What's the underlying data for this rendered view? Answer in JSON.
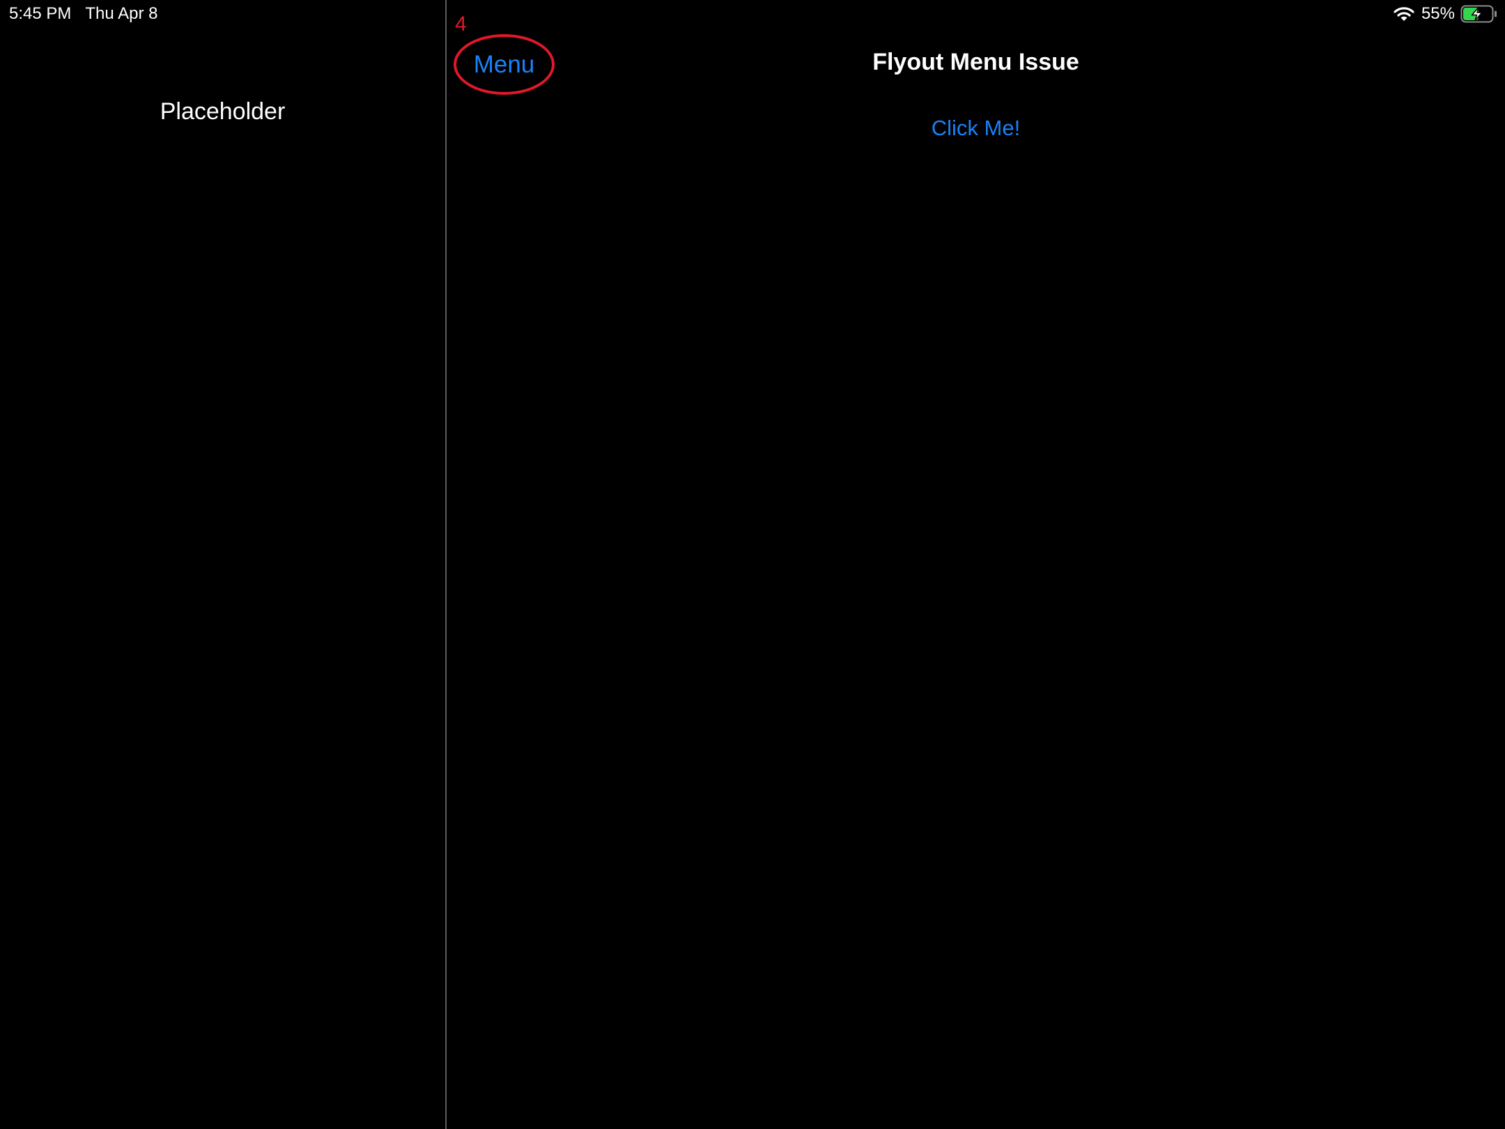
{
  "status_bar": {
    "time": "5:45 PM",
    "date": "Thu Apr 8",
    "battery_percent": "55%",
    "battery_level": 0.55,
    "battery_charging": true,
    "wifi_icon": "wifi-icon",
    "battery_icon": "battery-charging-icon",
    "battery_color": "#32d74b"
  },
  "sidebar": {
    "title": "Placeholder"
  },
  "navigation": {
    "menu_label": "Menu",
    "title": "Flyout Menu Issue"
  },
  "annotation": {
    "number": "4",
    "color": "#e0182a"
  },
  "main": {
    "button_label": "Click Me!"
  },
  "colors": {
    "background": "#000000",
    "accent": "#1a82f7",
    "text": "#ffffff",
    "divider": "#5c5c5e"
  }
}
